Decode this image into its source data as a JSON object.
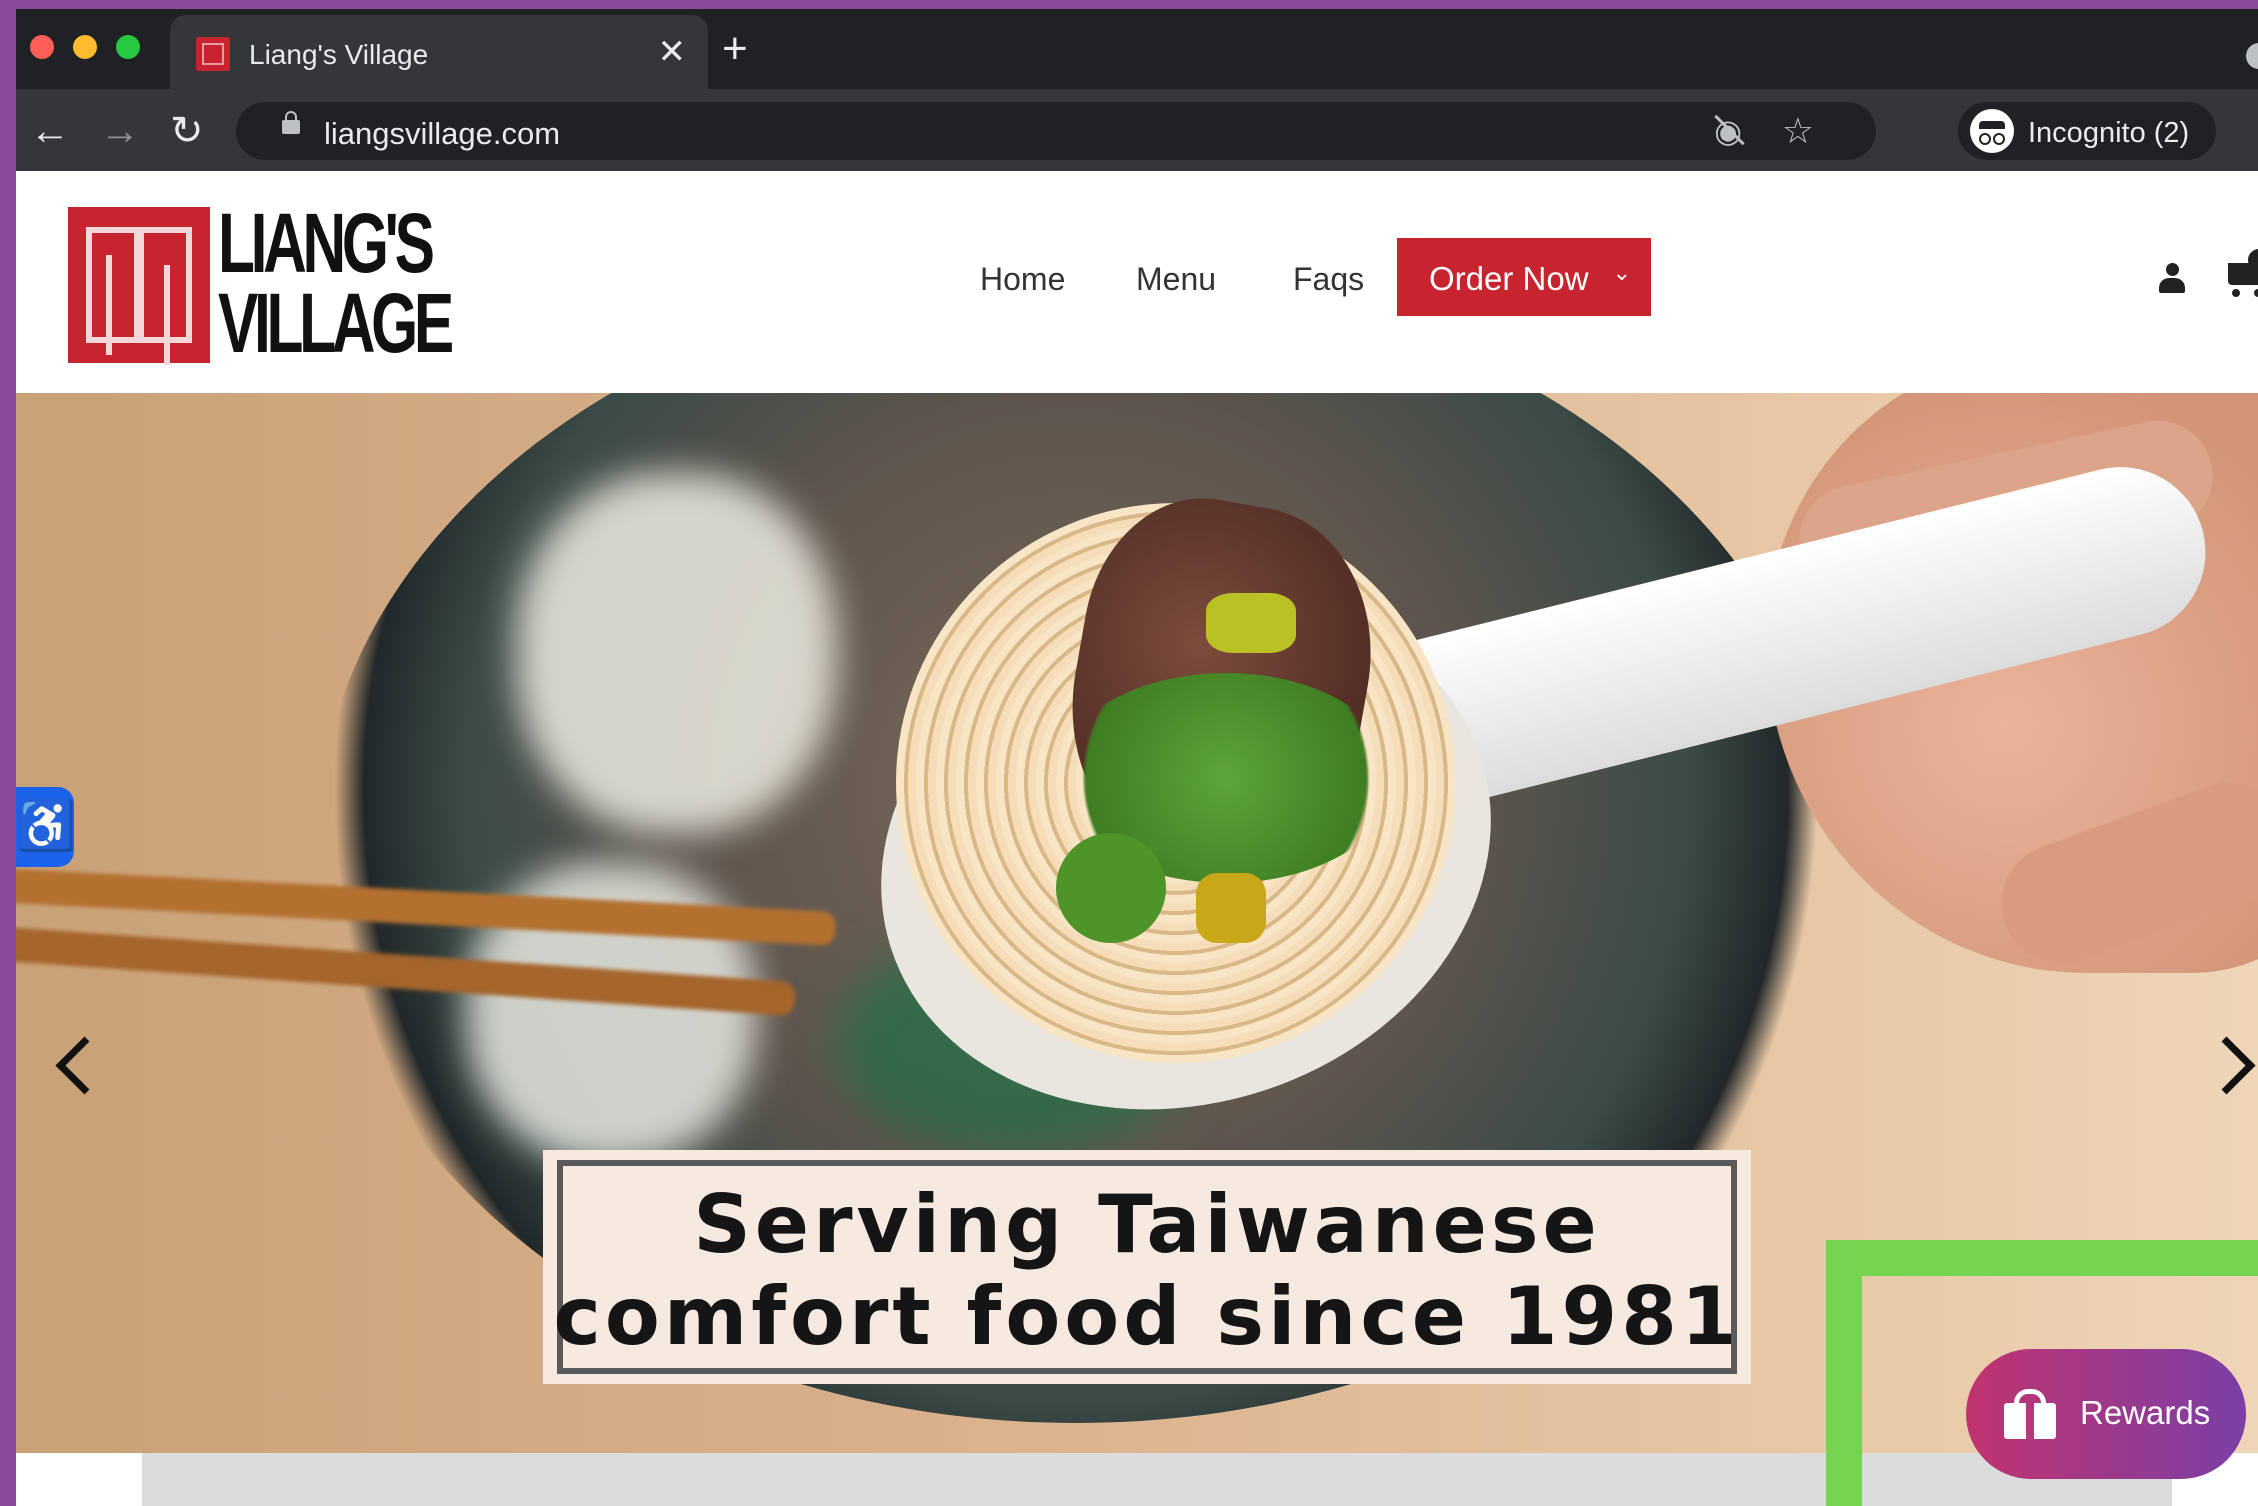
{
  "browser": {
    "tab": {
      "title": "Liang's Village",
      "close": "✕"
    },
    "new_tab": "+",
    "nav": {
      "back": "←",
      "forward": "→",
      "reload": "↻"
    },
    "url": "liangsvillage.com",
    "incognito_label": "Incognito (2)"
  },
  "site": {
    "logo": {
      "line1": "LIANG'S",
      "line2": "VILLAGE"
    },
    "nav": {
      "home": "Home",
      "menu": "Menu",
      "faqs": "Faqs",
      "order": "Order Now",
      "order_caret": "⌄"
    },
    "brand_color": "#c8242f"
  },
  "hero": {
    "caption_line1": "Serving Taiwanese",
    "caption_line2": "comfort food since 1981",
    "prev_arrow": "previous-slide",
    "next_arrow": "next-slide"
  },
  "accessibility_icon": "wheelchair-icon",
  "rewards": {
    "label": "Rewards",
    "gradient": [
      "#c1336e",
      "#7a3fa6"
    ]
  },
  "highlight_color": "#74d34f"
}
